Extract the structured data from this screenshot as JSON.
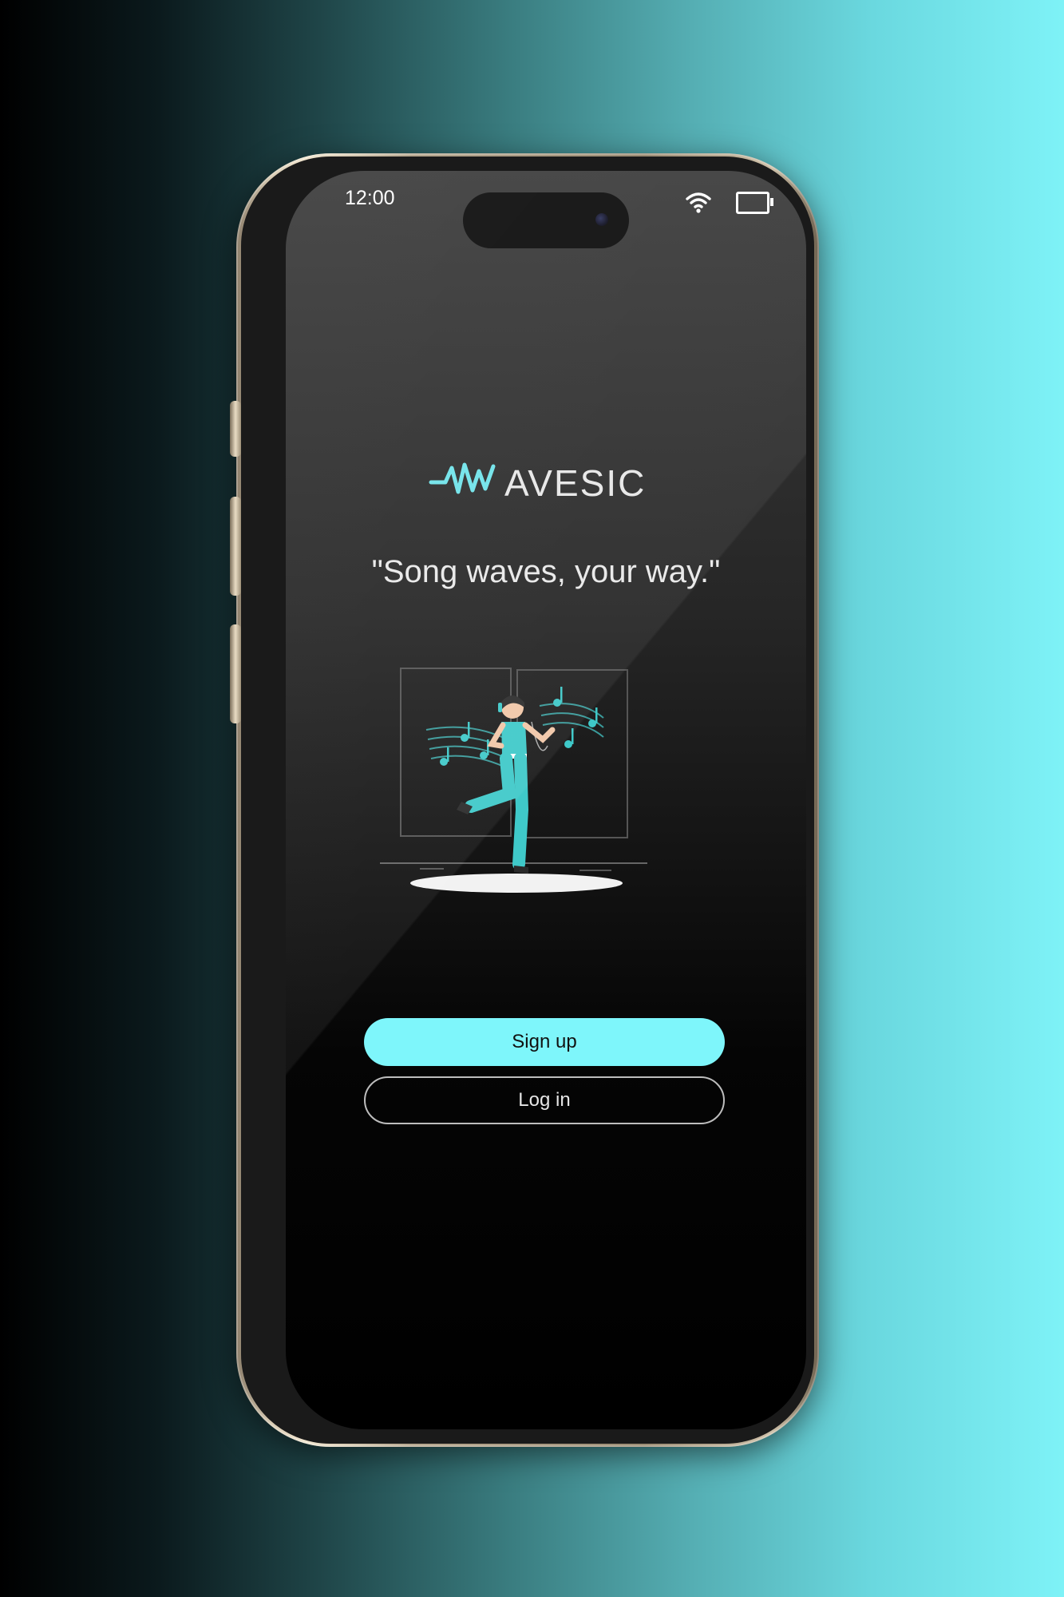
{
  "status_bar": {
    "time": "12:00",
    "wifi_icon": "wifi-icon",
    "battery_icon": "battery-icon"
  },
  "app": {
    "logo_text": "AVESIC",
    "logo_mark": "wave-icon",
    "tagline": "\"Song waves, your way.\""
  },
  "buttons": {
    "signup_label": "Sign up",
    "login_label": "Log in"
  },
  "colors": {
    "accent": "#7ef6fb",
    "background_dark": "#000000",
    "illustration_teal": "#3fc9c9"
  }
}
